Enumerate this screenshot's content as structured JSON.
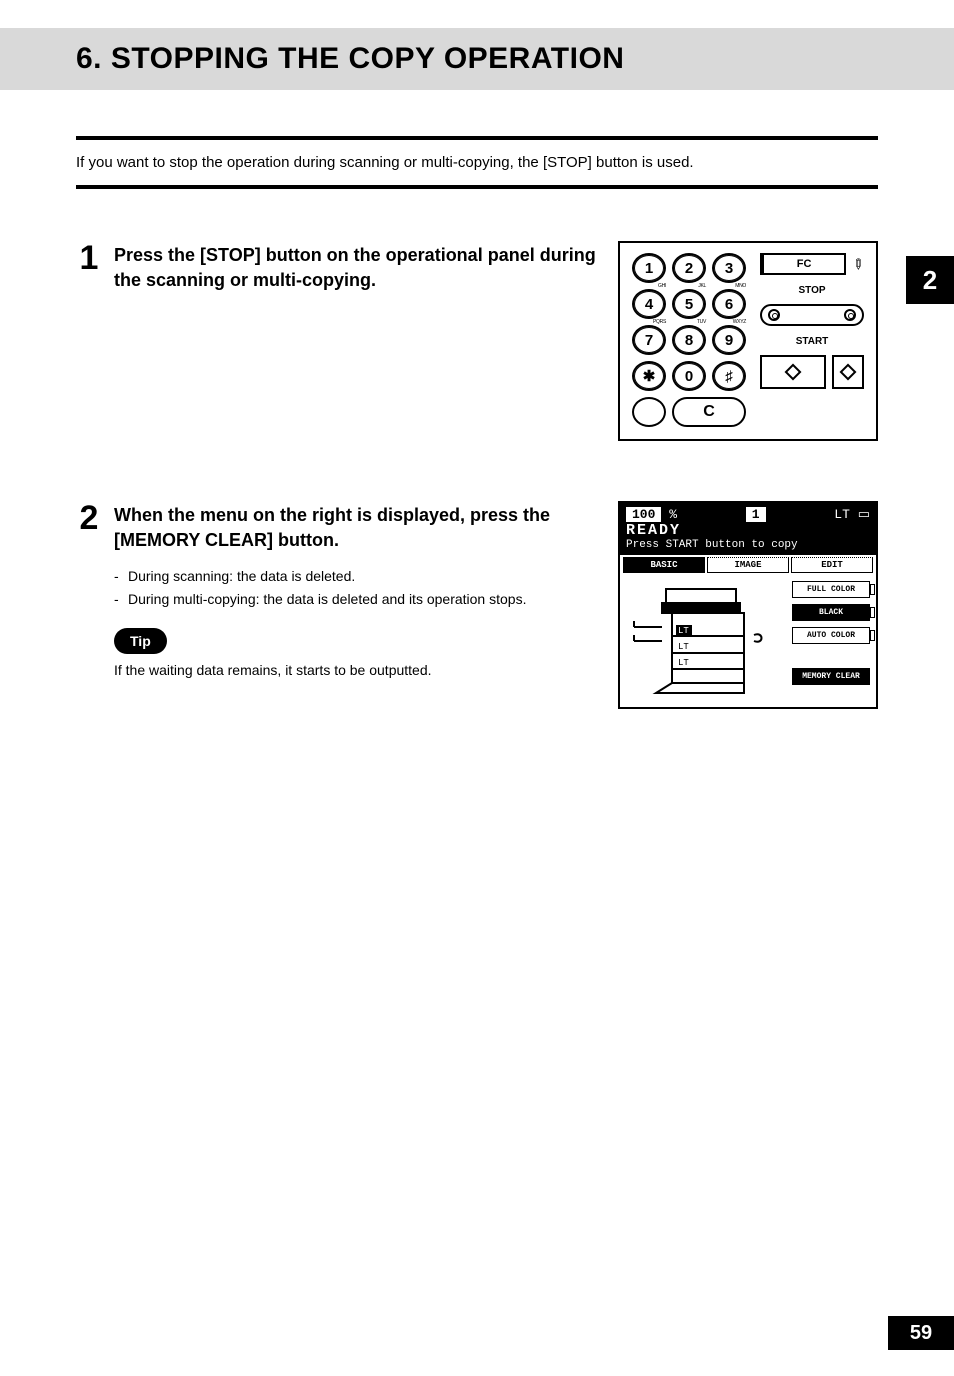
{
  "title": "6. STOPPING THE COPY OPERATION",
  "intro": "If you want to stop the operation during scanning or multi-copying, the [STOP] button is used.",
  "side_tab": "2",
  "page_number": "59",
  "steps": [
    {
      "num": "1",
      "title": "Press the [STOP] button on the operational panel during the scanning or multi-copying."
    },
    {
      "num": "2",
      "title": "When the menu on the right is displayed, press the [MEMORY CLEAR] button.",
      "bullets": [
        "During scanning: the data is deleted.",
        "During multi-copying: the data is deleted and its operation stops."
      ],
      "tip_label": "Tip",
      "tip_text": "If the waiting data remains, it starts to be outputted."
    }
  ],
  "panel": {
    "keys": {
      "k1": "1",
      "k2": "2",
      "k3": "3",
      "k4": "4",
      "k5": "5",
      "k6": "6",
      "k7": "7",
      "k8": "8",
      "k9": "9",
      "kstar": "✱",
      "k0": "0",
      "khash": "♯",
      "sup4": "GHI",
      "sup5": "JKL",
      "sup6": "MNO",
      "sup7": "PQRS",
      "sup8": "TUV",
      "sup9": "WXYZ"
    },
    "c_label": "C",
    "fc_label": "FC",
    "stop_label": "STOP",
    "start_label": "START"
  },
  "screen": {
    "zoom": "100",
    "zoom_unit": "%",
    "count": "1",
    "paper": "LT",
    "ready": "READY",
    "msg": "Press START button to copy",
    "tabs": {
      "basic": "BASIC",
      "image": "IMAGE",
      "edit": "EDIT"
    },
    "trays": {
      "t1": "LT",
      "t2": "LT",
      "t3": "LT"
    },
    "buttons": {
      "full_color": "FULL COLOR",
      "black": "BLACK",
      "auto_color": "AUTO COLOR",
      "memory_clear": "MEMORY CLEAR"
    }
  }
}
